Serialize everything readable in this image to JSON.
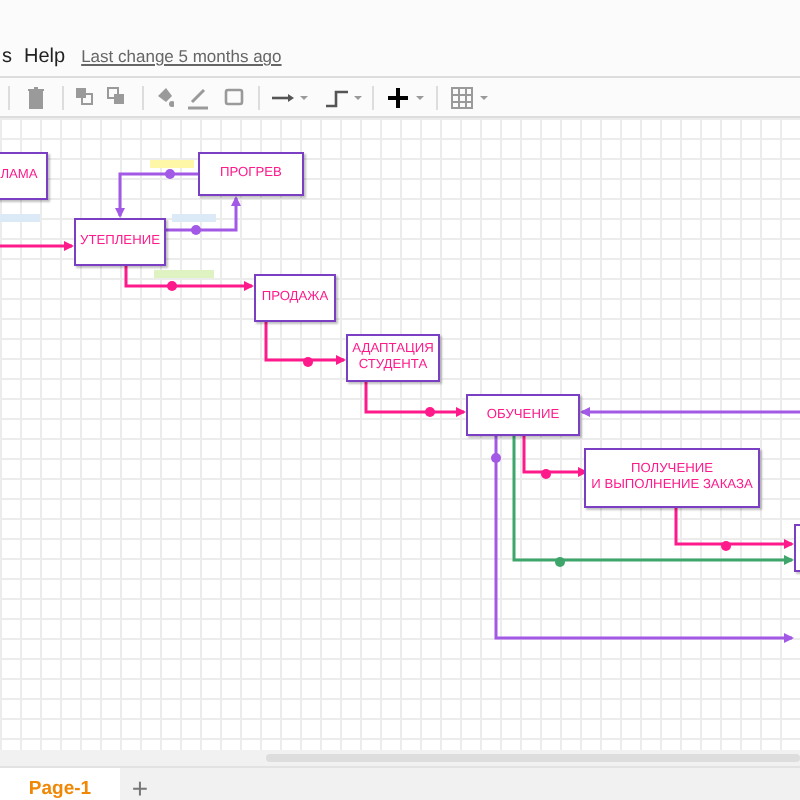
{
  "menu": [
    {
      "label": "s"
    },
    {
      "label": "Help"
    }
  ],
  "last_change": "Last change 5 months ago",
  "diagram": {
    "nodes": [
      {
        "title": "ЛАМА"
      },
      {
        "title": "ПРОГРЕВ"
      },
      {
        "title": "УТЕПЛЕНИЕ"
      },
      {
        "title": "ПРОДАЖА"
      },
      {
        "title": "АДАПТАЦИЯ\nСТУДЕНТА"
      },
      {
        "title": "ОБУЧЕНИЕ"
      },
      {
        "title": "ПОЛУЧЕНИЕ\nИ ВЫПОЛНЕНИЕ ЗАКАЗА"
      }
    ]
  },
  "pages": [
    {
      "label": "Page-1",
      "selected": true
    }
  ],
  "add_page": "+"
}
